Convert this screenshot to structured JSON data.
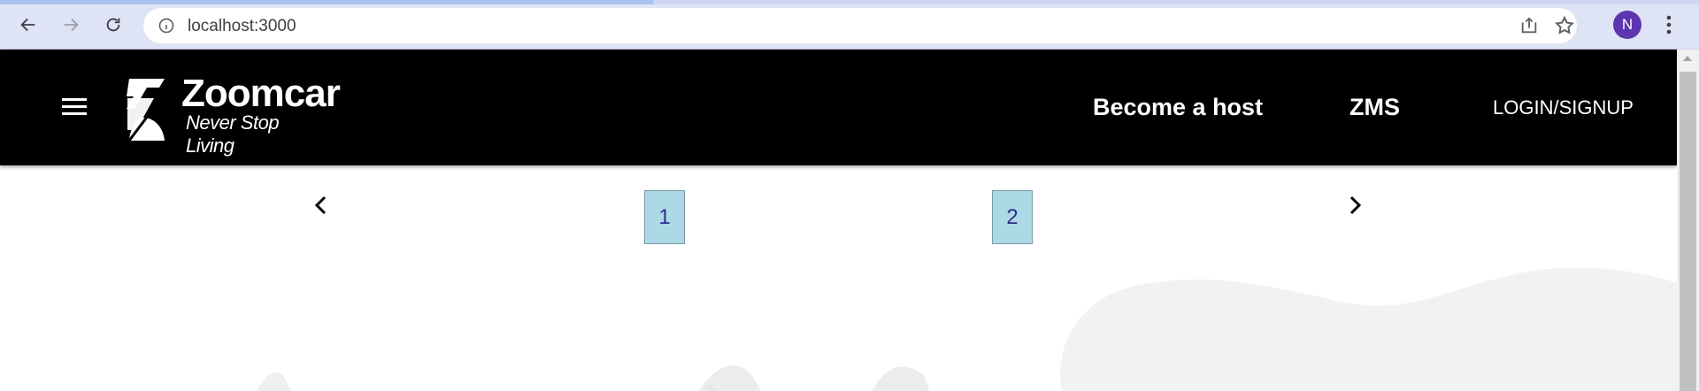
{
  "browser": {
    "url": "localhost:3000",
    "profile_initial": "N",
    "profile_color": "#5e35b1"
  },
  "header": {
    "brand": "Zoomcar",
    "tagline": "Never Stop Living",
    "nav": {
      "become_host": "Become a host",
      "zms": "ZMS",
      "login": "LOGIN/SIGNUP"
    },
    "background": "#000000"
  },
  "carousel": {
    "pages": [
      "1",
      "2"
    ],
    "page_button_color": "#add8e6"
  }
}
